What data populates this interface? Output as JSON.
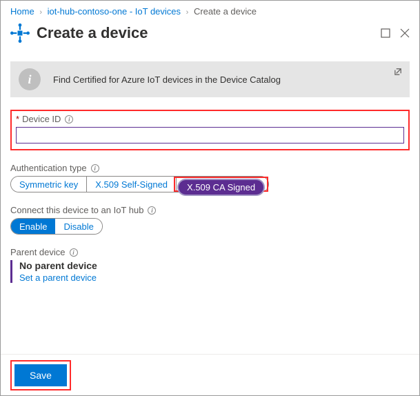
{
  "breadcrumb": {
    "home": "Home",
    "hub": "iot-hub-contoso-one - IoT devices",
    "current": "Create a device"
  },
  "header": {
    "title": "Create a device"
  },
  "banner": {
    "text": "Find Certified for Azure IoT devices in the Device Catalog"
  },
  "device_id": {
    "label": "Device ID",
    "value": ""
  },
  "auth": {
    "label": "Authentication type",
    "options": {
      "sym": "Symmetric key",
      "self": "X.509 Self-Signed",
      "ca": "X.509 CA Signed"
    }
  },
  "connect": {
    "label": "Connect this device to an IoT hub",
    "enable": "Enable",
    "disable": "Disable"
  },
  "parent": {
    "label": "Parent device",
    "none": "No parent device",
    "set": "Set a parent device"
  },
  "footer": {
    "save": "Save"
  }
}
